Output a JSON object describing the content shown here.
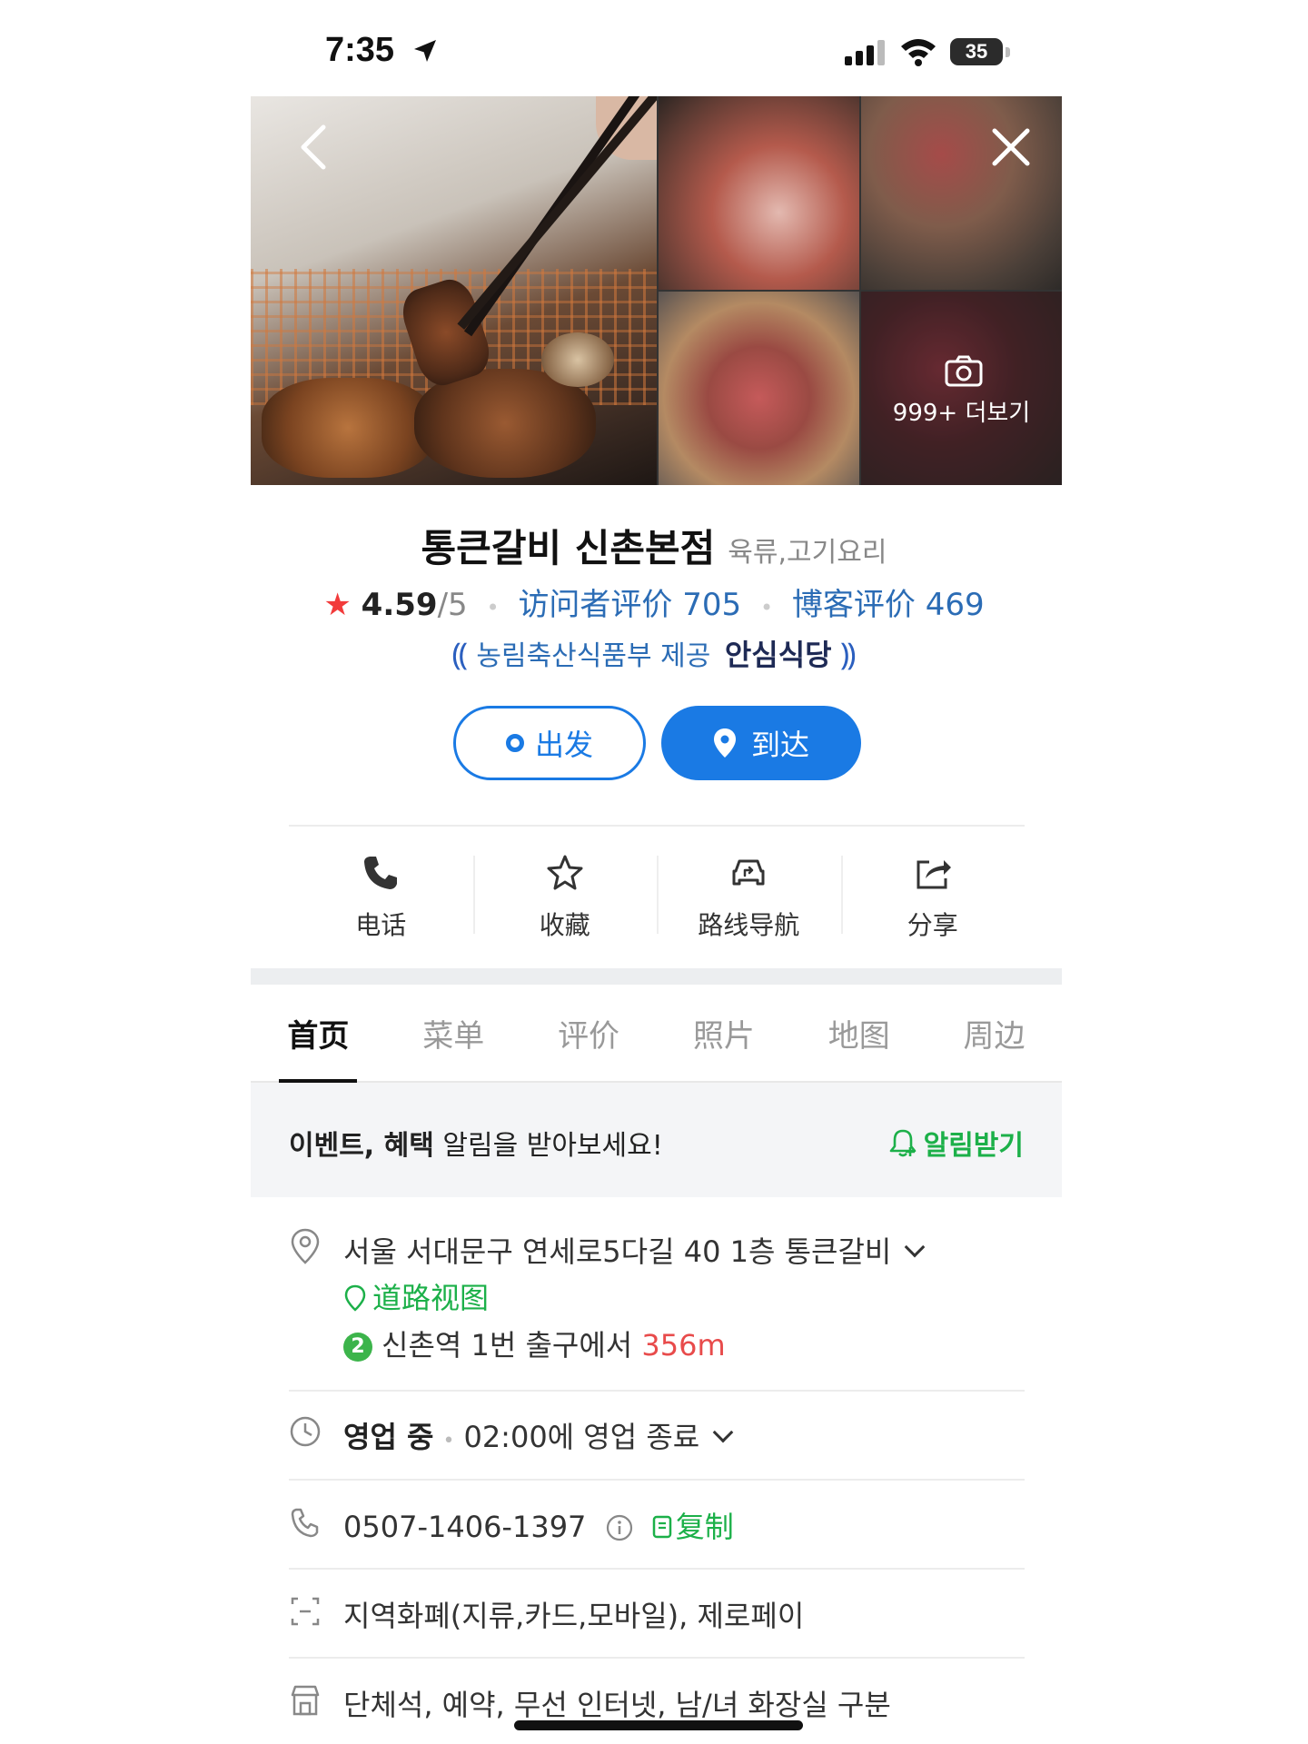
{
  "status_bar": {
    "time": "7:35",
    "battery": "35"
  },
  "gallery": {
    "more_label": "999+ 더보기"
  },
  "place": {
    "name": "통큰갈비 신촌본점",
    "category": "육류,고기요리",
    "rating": "4.59",
    "rating_max": "/5",
    "visitor_reviews": "访问者评价 705",
    "blog_reviews": "博客评价 469",
    "badge_text": "농림축산식품부 제공",
    "badge_strong": "안심식당"
  },
  "buttons": {
    "depart": "出发",
    "arrive": "到达"
  },
  "actions": [
    {
      "label": "电话",
      "icon": "phone-icon"
    },
    {
      "label": "收藏",
      "icon": "star-outline-icon"
    },
    {
      "label": "路线导航",
      "icon": "car-route-icon"
    },
    {
      "label": "分享",
      "icon": "share-icon"
    }
  ],
  "tabs": [
    "首页",
    "菜单",
    "评价",
    "照片",
    "地图",
    "周边"
  ],
  "notice": {
    "bold1": "이벤트, 혜택",
    "rest": " 알림을 받아보세요!",
    "button": "알림받기"
  },
  "info": {
    "address": "서울 서대문구 연세로5다길 40 1층 통큰갈비",
    "street_view": "道路视图",
    "subway_line": "2",
    "subway_text": "신촌역 1번 출구에서 ",
    "subway_distance": "356m",
    "hours_status": "영업 중",
    "hours_detail": "02:00에 영업 종료",
    "phone": "0507-1406-1397",
    "copy_label": "复制",
    "payment": "지역화폐(지류,카드,모바일), 제로페이",
    "facilities": "단체석, 예약, 무선 인터넷, 남/녀 화장실 구분"
  },
  "colors": {
    "accent": "#1a7ae4",
    "green": "#1cb049",
    "star": "#f23b3b",
    "link": "#2b6cb5"
  }
}
